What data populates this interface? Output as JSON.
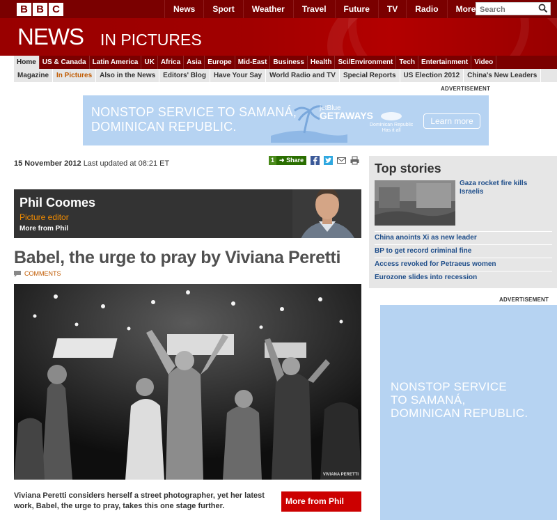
{
  "header": {
    "logo_letters": [
      "B",
      "B",
      "C"
    ],
    "global_nav": [
      "News",
      "Sport",
      "Weather",
      "Travel",
      "Future",
      "TV",
      "Radio",
      "More..."
    ],
    "search_placeholder": "Search"
  },
  "masthead": {
    "news": "NEWS",
    "section": "IN PICTURES"
  },
  "nav_primary": [
    "Home",
    "US & Canada",
    "Latin America",
    "UK",
    "Africa",
    "Asia",
    "Europe",
    "Mid-East",
    "Business",
    "Health",
    "Sci/Environment",
    "Tech",
    "Entertainment",
    "Video"
  ],
  "nav_secondary": [
    "Magazine",
    "In Pictures",
    "Also in the News",
    "Editors' Blog",
    "Have Your Say",
    "World Radio and TV",
    "Special Reports",
    "US Election 2012",
    "China's New Leaders"
  ],
  "ads": {
    "label": "ADVERTISEMENT",
    "banner_text_line1": "NONSTOP SERVICE TO SAMANÁ,",
    "banner_text_line2": "DOMINICAN REPUBLIC.",
    "banner_brand_line1": "jetBlue",
    "banner_brand_line2": "GETAWAYS",
    "banner_dr_line1": "Dominican Republic",
    "banner_dr_line2": "Has it all",
    "banner_cta": "Learn more",
    "side_line1": "NONSTOP SERVICE",
    "side_line2": "TO SAMANÁ,",
    "side_line3": "DOMINICAN REPUBLIC."
  },
  "article": {
    "date": "15 November 2012",
    "updated": "Last updated at 08:21 ET",
    "share_count": "1",
    "share_label": "Share",
    "author_name": "Phil Coomes",
    "author_role": "Picture editor",
    "author_more": "More from Phil",
    "headline": "Babel, the urge to pray by Viviana Peretti",
    "comments": "COMMENTS",
    "photo_credit": "VIVIANA PERETTI",
    "intro": "Viviana Peretti considers herself a street photographer, yet her latest work, Babel, the urge to pray, takes this one stage further.",
    "more_box": "More from Phil"
  },
  "top_stories": {
    "title": "Top stories",
    "lead": "Gaza rocket fire kills Israelis",
    "items": [
      "China anoints Xi as new leader",
      "BP to get record criminal fine",
      "Access revoked for Petraeus women",
      "Eurozone slides into recession"
    ]
  },
  "colors": {
    "bbc_red": "#990000",
    "dark_red": "#7a0000",
    "link_blue": "#1f4e8a",
    "accent_orange": "#c05a00",
    "ad_blue": "#b6d3f2"
  }
}
